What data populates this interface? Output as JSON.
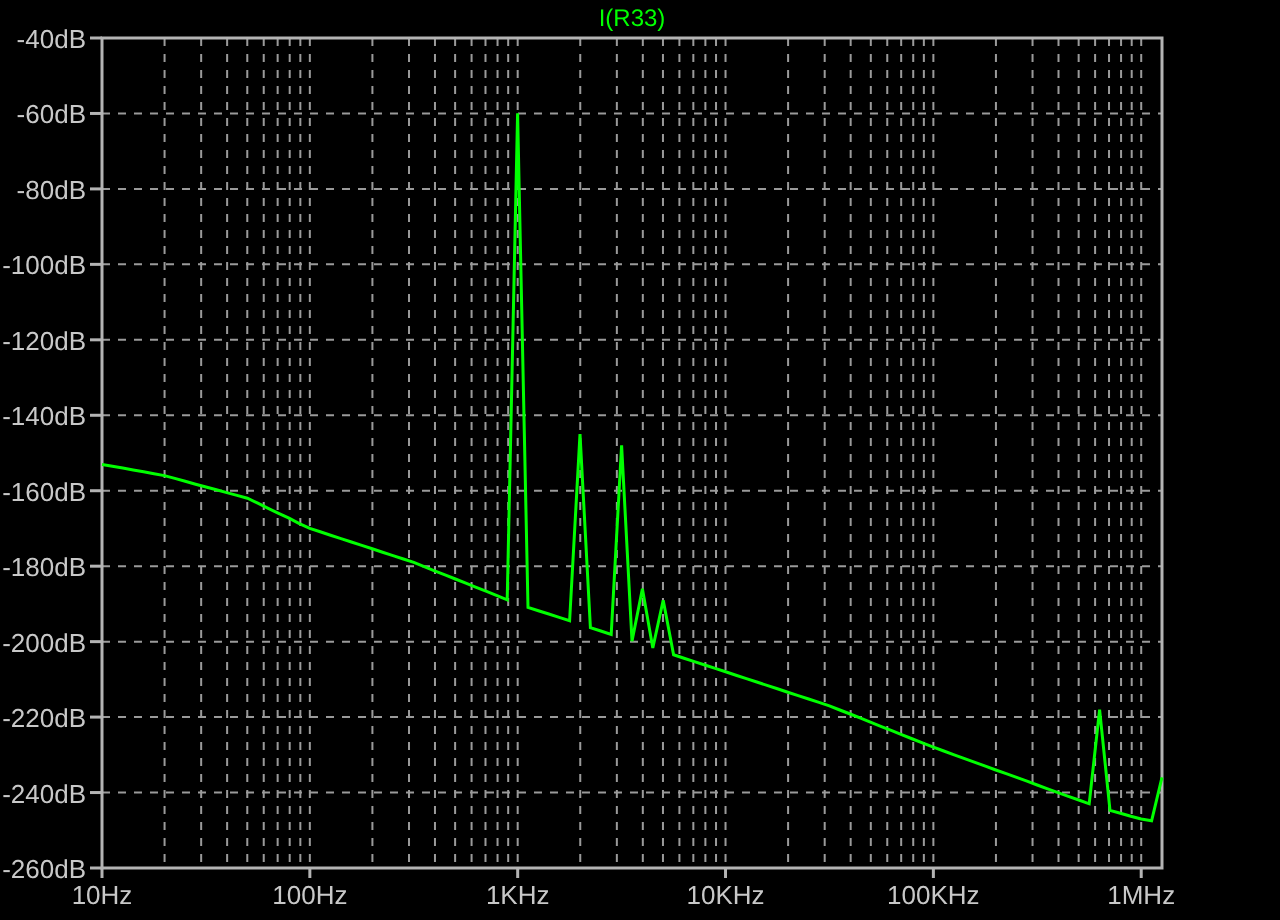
{
  "plot": {
    "chart_data": {
      "type": "line",
      "grid": true,
      "ylim": [
        -260,
        -40
      ],
      "categories": [
        "10Hz",
        null,
        null,
        null,
        null,
        null,
        null,
        null,
        null,
        null,
        null,
        null,
        null,
        null,
        null,
        null,
        null,
        null,
        null,
        null,
        "100Hz",
        null,
        null,
        null,
        null,
        null,
        null,
        null,
        null,
        null,
        null,
        null,
        null,
        null,
        null,
        null,
        null,
        null,
        null,
        null,
        "1KHz",
        null,
        null,
        null,
        null,
        null,
        null,
        null,
        null,
        null,
        null,
        null,
        null,
        null,
        null,
        null,
        null,
        null,
        null,
        null,
        "10KHz",
        null,
        null,
        null,
        null,
        null,
        null,
        null,
        null,
        null,
        null,
        null,
        null,
        null,
        null,
        null,
        null,
        null,
        null,
        null,
        "100KHz",
        null,
        null,
        null,
        null,
        null,
        null,
        null,
        null,
        null,
        null,
        null,
        null,
        null,
        null,
        null,
        null,
        null,
        null,
        null,
        "1MHz",
        null,
        null
      ],
      "yticks": [
        {
          "value": -40,
          "label": "-40dB"
        },
        {
          "value": -60,
          "label": "-60dB"
        },
        {
          "value": -80,
          "label": "-80dB"
        },
        {
          "value": -100,
          "label": "-100dB"
        },
        {
          "value": -120,
          "label": "-120dB"
        },
        {
          "value": -140,
          "label": "-140dB"
        },
        {
          "value": -160,
          "label": "-160dB"
        },
        {
          "value": -180,
          "label": "-180dB"
        },
        {
          "value": -200,
          "label": "-200dB"
        },
        {
          "value": -220,
          "label": "-220dB"
        },
        {
          "value": -240,
          "label": "-240dB"
        },
        {
          "value": -260,
          "label": "-260dB"
        }
      ],
      "series": [
        {
          "name": "I(R33)",
          "color": "#00ff00",
          "values": [
            -153,
            -153.5,
            -154,
            -154.5,
            -155,
            -155.5,
            -156,
            -156.75,
            -157.5,
            -158.25,
            -159,
            -159.75,
            -160.5,
            -161.25,
            -162,
            -163.3,
            -164.7,
            -166,
            -167.3,
            -168.7,
            -170,
            -170.9,
            -171.8,
            -172.7,
            -173.6,
            -174.5,
            -175.4,
            -176.3,
            -177.2,
            -178.1,
            -179,
            -180.1,
            -181.2,
            -182.3,
            -183.4,
            -184.5,
            -185.6,
            -186.7,
            -187.8,
            -188.9,
            -60,
            -190.9,
            -191.8,
            -192.7,
            -193.6,
            -194.5,
            -145,
            -196.3,
            -197.2,
            -198.1,
            -148,
            -199.9,
            -186,
            -201.7,
            -189,
            -203.5,
            -204.4,
            -205.3,
            -206.2,
            -207.1,
            -208,
            -208.9,
            -209.8,
            -210.7,
            -211.6,
            -212.5,
            -213.4,
            -214.3,
            -215.2,
            -216.1,
            -217,
            -218.1,
            -219.2,
            -220.3,
            -221.4,
            -222.5,
            -223.6,
            -224.7,
            -225.8,
            -226.9,
            -228,
            -229,
            -230,
            -231,
            -232,
            -233,
            -234,
            -235,
            -236,
            -237,
            -238,
            -239,
            -240,
            -241,
            -242,
            -243,
            -218,
            -244.75,
            -245.5,
            -246.25,
            -247,
            -247.5,
            -236
          ]
        }
      ]
    }
  }
}
